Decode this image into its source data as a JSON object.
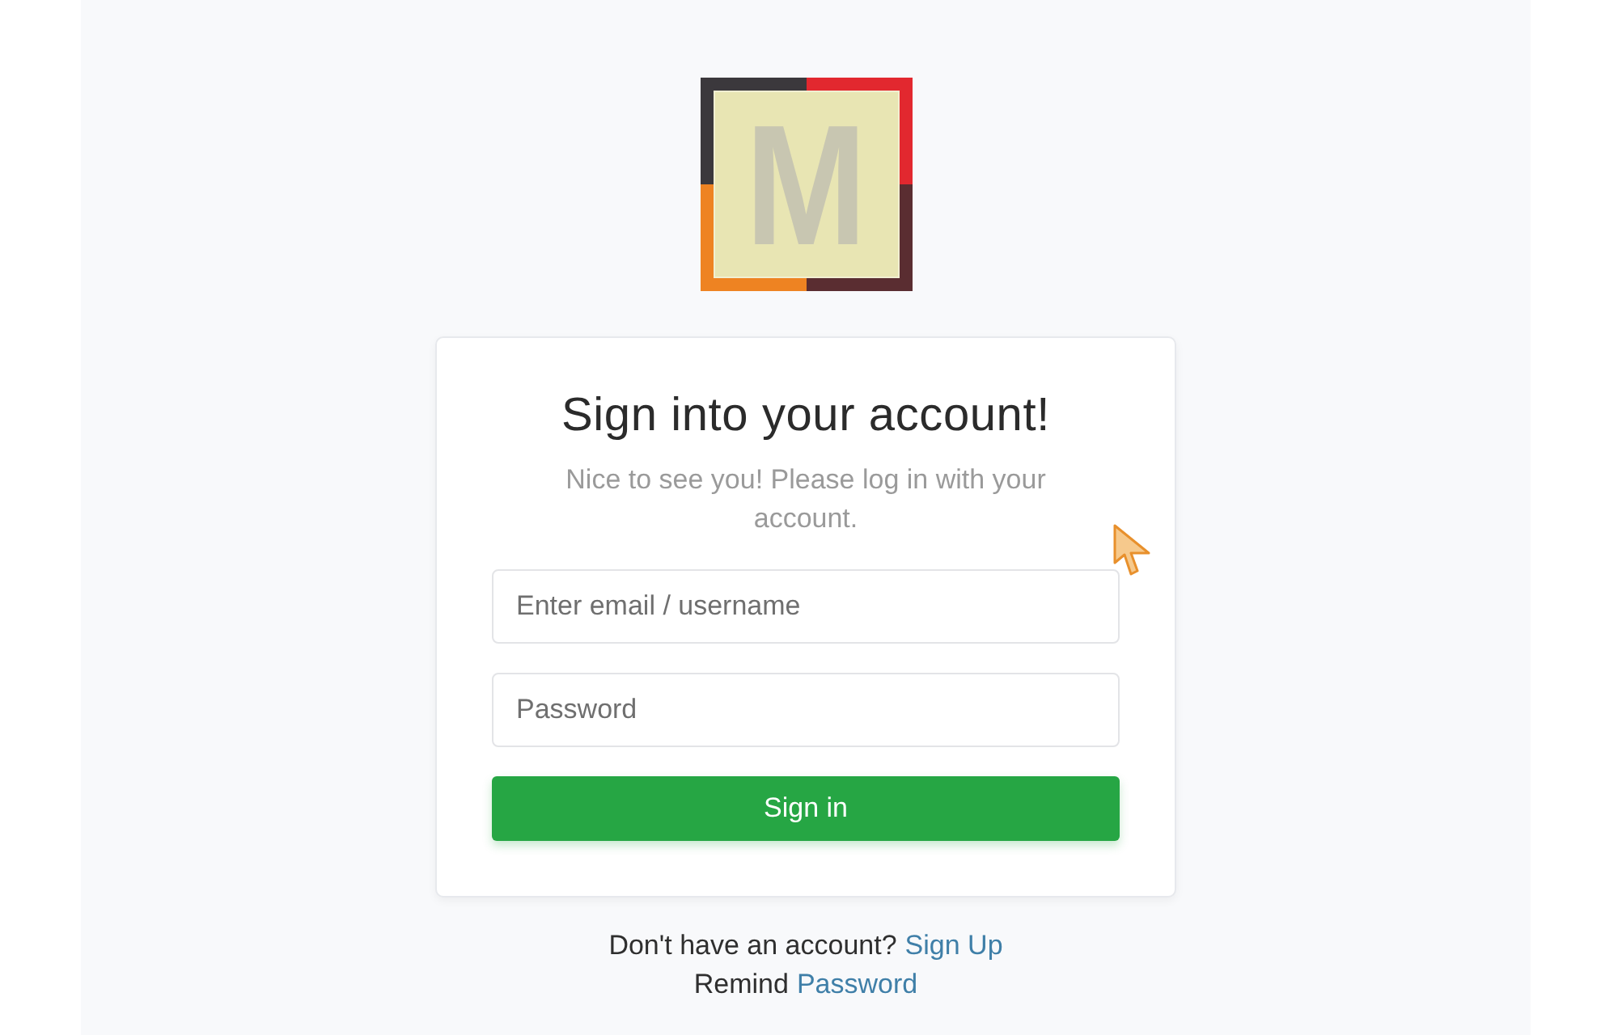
{
  "logo": {
    "letter": "M"
  },
  "card": {
    "title": "Sign into your account!",
    "subtitle": "Nice to see you! Please log in with your account.",
    "fields": [
      {
        "placeholder": "Enter email / username"
      },
      {
        "placeholder": "Password"
      }
    ],
    "submit": {
      "label": "Sign in"
    }
  },
  "footer": [
    {
      "text": "Don't have an account?",
      "link": "Sign Up"
    },
    {
      "text": "Remind",
      "link": "Password"
    }
  ]
}
